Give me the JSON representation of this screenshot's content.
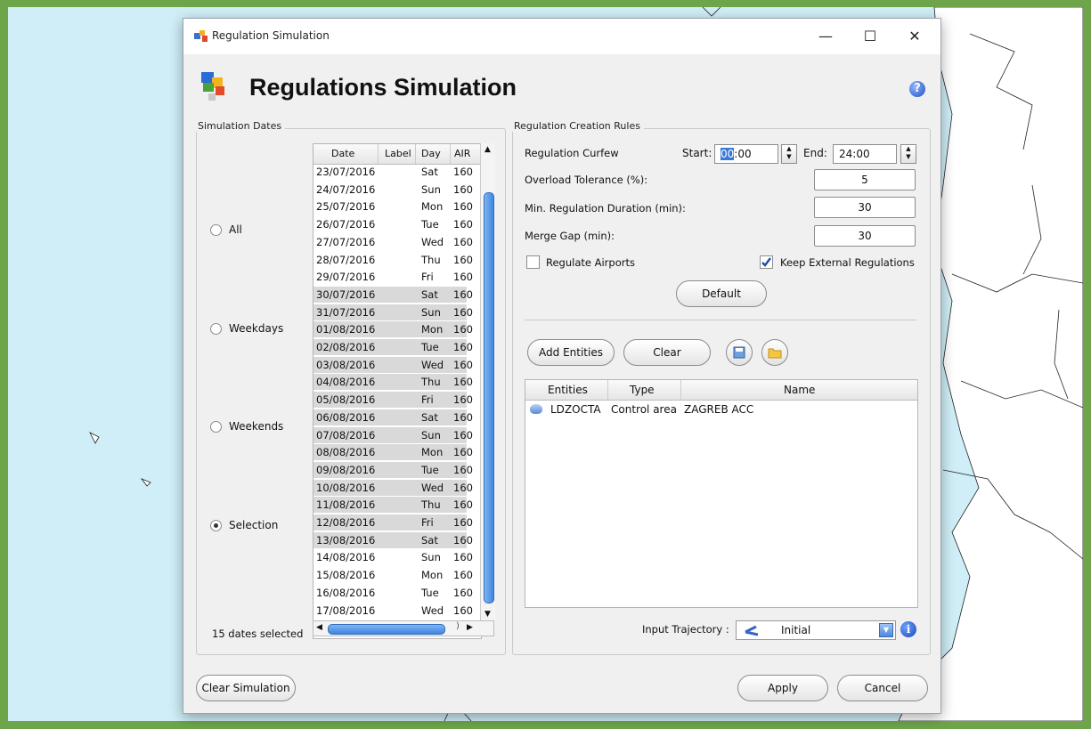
{
  "window": {
    "title": "Regulation Simulation",
    "minimize": "—",
    "maximize": "☐",
    "close": "✕"
  },
  "header": {
    "title": "Regulations Simulation",
    "help": "?"
  },
  "dates": {
    "group_label": "Simulation Dates",
    "radios": [
      {
        "label": "All",
        "selected": false
      },
      {
        "label": "Weekdays",
        "selected": false
      },
      {
        "label": "Weekends",
        "selected": false
      },
      {
        "label": "Selection",
        "selected": true
      }
    ],
    "columns": [
      "Date",
      "Label",
      "Day",
      "AIR"
    ],
    "rows": [
      {
        "date": "23/07/2016",
        "day": "Sat",
        "air": "160",
        "selected": false
      },
      {
        "date": "24/07/2016",
        "day": "Sun",
        "air": "160",
        "selected": false
      },
      {
        "date": "25/07/2016",
        "day": "Mon",
        "air": "160",
        "selected": false
      },
      {
        "date": "26/07/2016",
        "day": "Tue",
        "air": "160",
        "selected": false
      },
      {
        "date": "27/07/2016",
        "day": "Wed",
        "air": "160",
        "selected": false
      },
      {
        "date": "28/07/2016",
        "day": "Thu",
        "air": "160",
        "selected": false
      },
      {
        "date": "29/07/2016",
        "day": "Fri",
        "air": "160",
        "selected": false
      },
      {
        "date": "30/07/2016",
        "day": "Sat",
        "air": "160",
        "selected": true
      },
      {
        "date": "31/07/2016",
        "day": "Sun",
        "air": "160",
        "selected": true
      },
      {
        "date": "01/08/2016",
        "day": "Mon",
        "air": "160",
        "selected": true
      },
      {
        "date": "02/08/2016",
        "day": "Tue",
        "air": "160",
        "selected": true
      },
      {
        "date": "03/08/2016",
        "day": "Wed",
        "air": "160",
        "selected": true
      },
      {
        "date": "04/08/2016",
        "day": "Thu",
        "air": "160",
        "selected": true
      },
      {
        "date": "05/08/2016",
        "day": "Fri",
        "air": "160",
        "selected": true
      },
      {
        "date": "06/08/2016",
        "day": "Sat",
        "air": "160",
        "selected": true
      },
      {
        "date": "07/08/2016",
        "day": "Sun",
        "air": "160",
        "selected": true
      },
      {
        "date": "08/08/2016",
        "day": "Mon",
        "air": "160",
        "selected": true
      },
      {
        "date": "09/08/2016",
        "day": "Tue",
        "air": "160",
        "selected": true
      },
      {
        "date": "10/08/2016",
        "day": "Wed",
        "air": "160",
        "selected": true
      },
      {
        "date": "11/08/2016",
        "day": "Thu",
        "air": "160",
        "selected": true
      },
      {
        "date": "12/08/2016",
        "day": "Fri",
        "air": "160",
        "selected": true
      },
      {
        "date": "13/08/2016",
        "day": "Sat",
        "air": "160",
        "selected": true
      },
      {
        "date": "14/08/2016",
        "day": "Sun",
        "air": "160",
        "selected": false
      },
      {
        "date": "15/08/2016",
        "day": "Mon",
        "air": "160",
        "selected": false
      },
      {
        "date": "16/08/2016",
        "day": "Tue",
        "air": "160",
        "selected": false
      },
      {
        "date": "17/08/2016",
        "day": "Wed",
        "air": "160",
        "selected": false
      }
    ],
    "count_label": "15 dates selected"
  },
  "rules": {
    "group_label": "Regulation Creation Rules",
    "curfew_label": "Regulation Curfew",
    "start_label": "Start:",
    "start_hour": "00",
    "start_rest": ":00",
    "end_label": "End:",
    "end_value": "24:00",
    "overload_label": "Overload Tolerance (%):",
    "overload_value": "5",
    "min_duration_label": "Min. Regulation Duration (min):",
    "min_duration_value": "30",
    "merge_gap_label": "Merge Gap (min):",
    "merge_gap_value": "30",
    "regulate_airports_label": "Regulate Airports",
    "regulate_airports_checked": false,
    "keep_external_label": "Keep External Regulations",
    "keep_external_checked": true,
    "default_button": "Default"
  },
  "entities": {
    "add_button": "Add Entities",
    "clear_button": "Clear",
    "columns": [
      "Entities",
      "Type",
      "Name"
    ],
    "rows": [
      {
        "entity": "LDZOCTA",
        "type": "Control area",
        "name": "ZAGREB ACC"
      }
    ],
    "input_trajectory_label": "Input Trajectory :",
    "input_trajectory_value": "Initial"
  },
  "footer": {
    "clear_simulation": "Clear Simulation",
    "apply": "Apply",
    "cancel": "Cancel"
  },
  "colors": {
    "frame": "#6ea54a",
    "sea": "#cfeef7",
    "selection_row": "#d9d9d9",
    "scroll_blue": "#4a8fe0"
  }
}
